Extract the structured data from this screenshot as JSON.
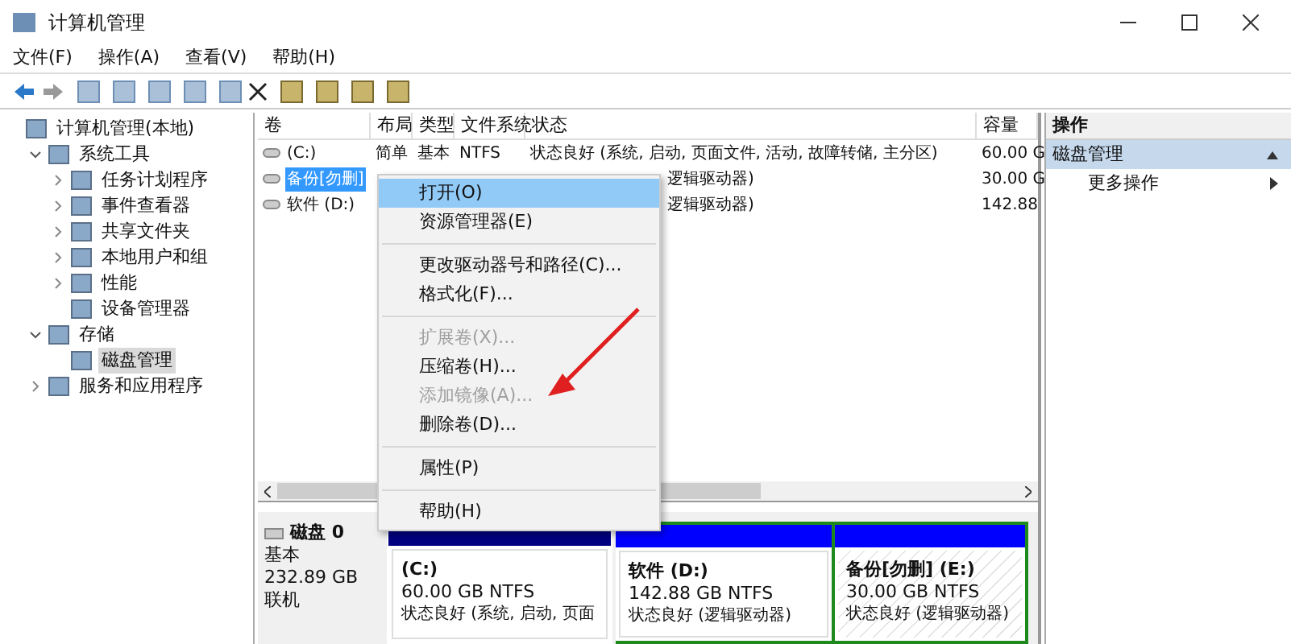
{
  "window": {
    "title": "计算机管理"
  },
  "menu": [
    "文件(F)",
    "操作(A)",
    "查看(V)",
    "帮助(H)"
  ],
  "tree": [
    {
      "label": "计算机管理(本地)",
      "selected": false,
      "children": [
        {
          "label": "系统工具",
          "selected": false,
          "expanded": true,
          "children": [
            {
              "label": "任务计划程序",
              "selected": false,
              "expanded": false
            },
            {
              "label": "事件查看器",
              "selected": false,
              "expanded": false
            },
            {
              "label": "共享文件夹",
              "selected": false,
              "expanded": false
            },
            {
              "label": "本地用户和组",
              "selected": false,
              "expanded": false
            },
            {
              "label": "性能",
              "selected": false,
              "expanded": false
            },
            {
              "label": "设备管理器",
              "selected": false
            }
          ]
        },
        {
          "label": "存储",
          "selected": false,
          "expanded": true,
          "children": [
            {
              "label": "磁盘管理",
              "selected": true
            }
          ]
        },
        {
          "label": "服务和应用程序",
          "selected": false,
          "expanded": false
        }
      ]
    }
  ],
  "table": {
    "columns": [
      "卷",
      "布局",
      "类型",
      "文件系统",
      "状态",
      "容量"
    ],
    "rows": [
      {
        "selected": false,
        "volume": "(C:)",
        "layout": "简单",
        "type": "基本",
        "fs": "NTFS",
        "status": "状态良好 (系统, 启动, 页面文件, 活动, 故障转储, 主分区)",
        "capacity": "60.00 G"
      },
      {
        "selected": true,
        "volume": "备份[勿删]",
        "status": "逻辑驱动器)",
        "capacity": "30.00 G"
      },
      {
        "selected": false,
        "volume": "软件 (D:)",
        "status": "逻辑驱动器)",
        "capacity": "142.88"
      }
    ]
  },
  "context_menu": [
    {
      "kind": "item",
      "label": "打开(O)",
      "selected": true,
      "disabled": false
    },
    {
      "kind": "item",
      "label": "资源管理器(E)",
      "selected": false,
      "disabled": false
    },
    {
      "kind": "separator"
    },
    {
      "kind": "item",
      "label": "更改驱动器号和路径(C)...",
      "selected": false,
      "disabled": false
    },
    {
      "kind": "item",
      "label": "格式化(F)...",
      "selected": false,
      "disabled": false
    },
    {
      "kind": "separator"
    },
    {
      "kind": "item",
      "label": "扩展卷(X)...",
      "selected": false,
      "disabled": true
    },
    {
      "kind": "item",
      "label": "压缩卷(H)...",
      "selected": false,
      "disabled": false
    },
    {
      "kind": "item",
      "label": "添加镜像(A)...",
      "selected": false,
      "disabled": true
    },
    {
      "kind": "item",
      "label": "删除卷(D)...",
      "selected": false,
      "disabled": false
    },
    {
      "kind": "separator"
    },
    {
      "kind": "item",
      "label": "属性(P)",
      "selected": false,
      "disabled": false
    },
    {
      "kind": "separator"
    },
    {
      "kind": "item",
      "label": "帮助(H)",
      "selected": false,
      "disabled": false
    }
  ],
  "disk": {
    "name": "磁盘 0",
    "type": "基本",
    "size": "232.89 GB",
    "status": "联机",
    "partitions": [
      {
        "kind": "primary",
        "name": "(C:)",
        "size": "60.00 GB NTFS",
        "status": "状态良好 (系统, 启动, 页面"
      },
      {
        "kind": "logical",
        "name": "软件 (D:)",
        "size": "142.88 GB NTFS",
        "status": "状态良好 (逻辑驱动器)"
      },
      {
        "kind": "logical-selected",
        "name": "备份[勿删] (E:)",
        "size": "30.00 GB NTFS",
        "status": "状态良好 (逻辑驱动器)"
      }
    ]
  },
  "actions": {
    "title": "操作",
    "section": "磁盘管理",
    "items": [
      "更多操作"
    ]
  }
}
